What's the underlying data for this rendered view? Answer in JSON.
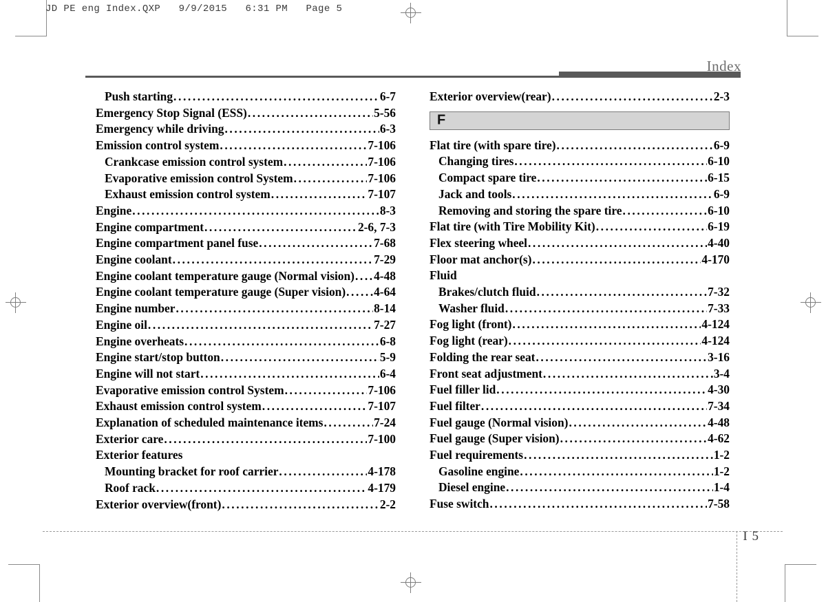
{
  "document": {
    "file_stamp": "JD PE eng Index.QXP   9/9/2015   6:31 PM   Page 5",
    "running_head": "Index",
    "folio": "I 5"
  },
  "left_column": {
    "entries": [
      {
        "title": "Push starting",
        "page": "6-7",
        "level": "sub",
        "leader": true
      },
      {
        "title": "Emergency Stop Signal (ESS)",
        "page": "5-56",
        "level": "main",
        "leader": true
      },
      {
        "title": "Emergency while driving",
        "page": "6-3",
        "level": "main",
        "leader": true
      },
      {
        "title": "Emission control system",
        "page": "7-106",
        "level": "main",
        "leader": true
      },
      {
        "title": "Crankcase emission control system",
        "page": "7-106",
        "level": "sub",
        "leader": true
      },
      {
        "title": "Evaporative emission control System",
        "page": "7-106",
        "level": "sub",
        "leader": true
      },
      {
        "title": "Exhaust emission control system",
        "page": "7-107",
        "level": "sub",
        "leader": true
      },
      {
        "title": "Engine",
        "page": "8-3",
        "level": "main",
        "leader": true
      },
      {
        "title": "Engine compartment",
        "page": "2-6, 7-3",
        "level": "main",
        "leader": true
      },
      {
        "title": "Engine compartment panel fuse",
        "page": "7-68",
        "level": "main",
        "leader": true
      },
      {
        "title": "Engine coolant",
        "page": "7-29",
        "level": "main",
        "leader": true
      },
      {
        "title": "Engine coolant temperature gauge (Normal vision)",
        "page": "4-48",
        "level": "main",
        "leader": true
      },
      {
        "title": "Engine coolant temperature gauge (Super vision)",
        "page": "4-64",
        "level": "main",
        "leader": true
      },
      {
        "title": "Engine number",
        "page": "8-14",
        "level": "main",
        "leader": true
      },
      {
        "title": "Engine oil",
        "page": "7-27",
        "level": "main",
        "leader": true
      },
      {
        "title": "Engine overheats",
        "page": "6-8",
        "level": "main",
        "leader": true
      },
      {
        "title": "Engine start/stop button",
        "page": "5-9",
        "level": "main",
        "leader": true
      },
      {
        "title": "Engine will not start",
        "page": "6-4",
        "level": "main",
        "leader": true
      },
      {
        "title": "Evaporative emission control System",
        "page": "7-106",
        "level": "main",
        "leader": true
      },
      {
        "title": "Exhaust emission control system",
        "page": "7-107",
        "level": "main",
        "leader": true
      },
      {
        "title": "Explanation of scheduled maintenance items",
        "page": "7-24",
        "level": "main",
        "leader": true
      },
      {
        "title": "Exterior care",
        "page": "7-100",
        "level": "main",
        "leader": true
      },
      {
        "title": "Exterior features",
        "page": "",
        "level": "main",
        "leader": false
      },
      {
        "title": "Mounting bracket for roof carrier",
        "page": "4-178",
        "level": "sub",
        "leader": true
      },
      {
        "title": "Roof rack",
        "page": "4-179",
        "level": "sub",
        "leader": true
      },
      {
        "title": "Exterior overview(front)",
        "page": "2-2",
        "level": "main",
        "leader": true
      }
    ]
  },
  "right_column": {
    "pre_section_entries": [
      {
        "title": "Exterior overview(rear)",
        "page": "2-3",
        "level": "main",
        "leader": true
      }
    ],
    "section_letter": "F",
    "entries": [
      {
        "title": "Flat tire (with spare tire)",
        "page": "6-9",
        "level": "main",
        "leader": true
      },
      {
        "title": "Changing tires",
        "page": "6-10",
        "level": "sub",
        "leader": true
      },
      {
        "title": "Compact spare tire",
        "page": "6-15",
        "level": "sub",
        "leader": true
      },
      {
        "title": "Jack and tools",
        "page": "6-9",
        "level": "sub",
        "leader": true
      },
      {
        "title": "Removing and storing the spare tire",
        "page": "6-10",
        "level": "sub",
        "leader": true
      },
      {
        "title": "Flat tire (with Tire Mobility Kit)",
        "page": "6-19",
        "level": "main",
        "leader": true
      },
      {
        "title": "Flex steering wheel",
        "page": "4-40",
        "level": "main",
        "leader": true
      },
      {
        "title": "Floor mat anchor(s)",
        "page": "4-170",
        "level": "main",
        "leader": true
      },
      {
        "title": "Fluid",
        "page": "",
        "level": "main",
        "leader": false
      },
      {
        "title": "Brakes/clutch fluid",
        "page": "7-32",
        "level": "sub",
        "leader": true
      },
      {
        "title": "Washer fluid",
        "page": "7-33",
        "level": "sub",
        "leader": true
      },
      {
        "title": "Fog light (front)",
        "page": "4-124",
        "level": "main",
        "leader": true
      },
      {
        "title": "Fog light (rear)",
        "page": "4-124",
        "level": "main",
        "leader": true
      },
      {
        "title": "Folding the rear seat",
        "page": "3-16",
        "level": "main",
        "leader": true
      },
      {
        "title": "Front seat adjustment",
        "page": "3-4",
        "level": "main",
        "leader": true
      },
      {
        "title": "Fuel filler lid",
        "page": "4-30",
        "level": "main",
        "leader": true
      },
      {
        "title": "Fuel filter",
        "page": "7-34",
        "level": "main",
        "leader": true
      },
      {
        "title": "Fuel gauge (Normal vision)",
        "page": "4-48",
        "level": "main",
        "leader": true
      },
      {
        "title": "Fuel gauge (Super vision)",
        "page": "4-62",
        "level": "main",
        "leader": true
      },
      {
        "title": "Fuel requirements",
        "page": "1-2",
        "level": "main",
        "leader": true
      },
      {
        "title": "Gasoline engine",
        "page": "1-2",
        "level": "sub",
        "leader": true
      },
      {
        "title": "Diesel engine",
        "page": "1-4",
        "level": "sub",
        "leader": true
      },
      {
        "title": "Fuse switch",
        "page": "7-58",
        "level": "main",
        "leader": true
      }
    ]
  }
}
